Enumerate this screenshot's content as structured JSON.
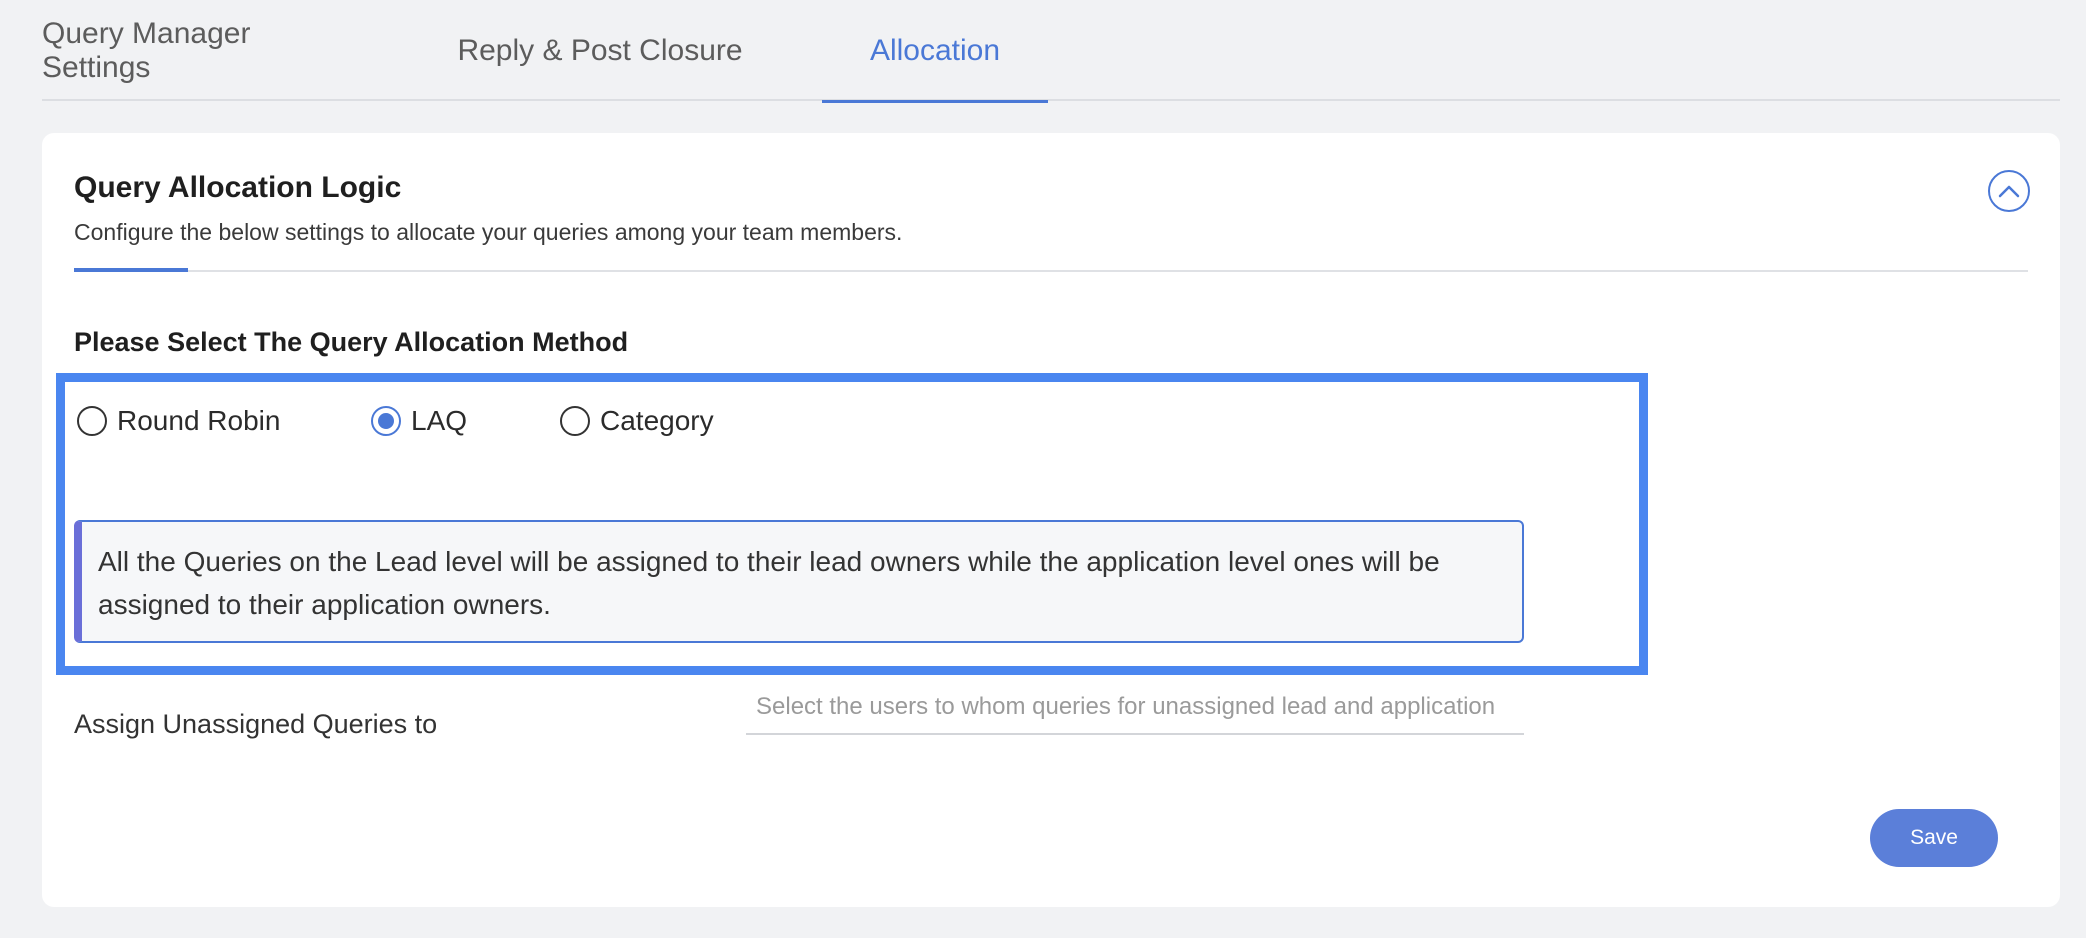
{
  "tabs": [
    {
      "label": "Query Manager Settings"
    },
    {
      "label": "Reply & Post Closure"
    },
    {
      "label": "Allocation"
    }
  ],
  "active_tab": "Allocation",
  "card": {
    "title": "Query Allocation Logic",
    "subtitle": "Configure the below settings to allocate your queries among your team members.",
    "collapse_icon": "chevron-up-icon"
  },
  "allocation": {
    "label": "Please Select The Query Allocation Method",
    "options": [
      {
        "label": "Round Robin",
        "checked": false
      },
      {
        "label": "LAQ",
        "checked": true
      },
      {
        "label": "Category",
        "checked": false
      }
    ],
    "info_text": "All the Queries on the Lead level will be assigned to their lead owners while the application level ones will be assigned to their application owners."
  },
  "assign": {
    "label": "Assign Unassigned Queries to",
    "placeholder": "Select the users to whom queries for unassigned lead and application"
  },
  "save_label": "Save",
  "colors": {
    "accent": "#4a78d6",
    "highlight_border": "#4a86f0",
    "save_button": "#5b7fd9"
  }
}
